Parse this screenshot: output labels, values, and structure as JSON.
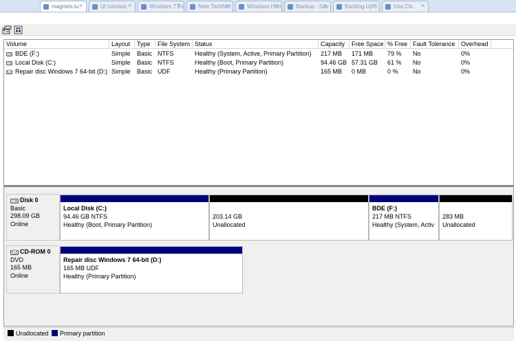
{
  "browser": {
    "tabs": [
      {
        "label": "magnets.tu",
        "active": true
      },
      {
        "label": "UI tutorials",
        "active": false
      },
      {
        "label": "Windows 7 Fo",
        "active": false
      },
      {
        "label": "New TechNet",
        "active": false
      },
      {
        "label": "Windows Hum",
        "active": false
      },
      {
        "label": "Backup - Sav",
        "active": false
      },
      {
        "label": "Backing Up ti",
        "active": false
      },
      {
        "label": "Usa Cls",
        "active": false
      }
    ],
    "tab_close_icon": "close-icon"
  },
  "toolbar": {
    "buttons": [
      {
        "name": "properties-button",
        "icon": "properties-icon"
      },
      {
        "name": "help-button",
        "icon": "help-icon"
      }
    ]
  },
  "volume_list": {
    "columns": [
      "Volume",
      "Layout",
      "Type",
      "File System",
      "Status",
      "Capacity",
      "Free Space",
      "% Free",
      "Fault Tolerance",
      "Overhead"
    ],
    "rows": [
      {
        "volume": "BDE (F:)",
        "icon": "drive-icon",
        "layout": "Simple",
        "type": "Basic",
        "fs": "NTFS",
        "status": "Healthy (System, Active, Primary Partition)",
        "capacity": "217 MB",
        "free": "171 MB",
        "pct": "79 %",
        "fault": "No",
        "overhead": "0%"
      },
      {
        "volume": "Local Disk (C:)",
        "icon": "drive-icon",
        "layout": "Simple",
        "type": "Basic",
        "fs": "NTFS",
        "status": "Healthy (Boot, Primary Partition)",
        "capacity": "94.46 GB",
        "free": "57.31 GB",
        "pct": "61 %",
        "fault": "No",
        "overhead": "0%"
      },
      {
        "volume": "Repair disc Windows 7 64-bit (D:)",
        "icon": "cd-drive-icon",
        "layout": "Simple",
        "type": "Basic",
        "fs": "UDF",
        "status": "Healthy (Primary Partition)",
        "capacity": "165 MB",
        "free": "0 MB",
        "pct": "0 %",
        "fault": "No",
        "overhead": "0%"
      }
    ]
  },
  "disks": [
    {
      "title": "Disk 0",
      "icon": "hard-disk-icon",
      "kind": "Basic",
      "size": "298.09 GB",
      "state": "Online",
      "partitions": [
        {
          "name": "Local Disk  (C:)",
          "line2": "94.46 GB NTFS",
          "line3": "Healthy (Boot, Primary Partition)",
          "kind": "primary"
        },
        {
          "name": "",
          "line2": "203.14 GB",
          "line3": "Unallocated",
          "kind": "unallocated"
        },
        {
          "name": "BDE  (F:)",
          "line2": "217 MB NTFS",
          "line3": "Healthy (System, Activ",
          "kind": "primary"
        },
        {
          "name": "",
          "line2": "283 MB",
          "line3": "Unallocated",
          "kind": "unallocated"
        }
      ]
    },
    {
      "title": "CD-ROM 0",
      "icon": "cd-rom-icon",
      "kind": "DVD",
      "size": "165 MB",
      "state": "Online",
      "partitions": [
        {
          "name": "Repair disc Windows 7 64-bit  (D:)",
          "line2": "165 MB UDF",
          "line3": "Healthy (Primary Partition)",
          "kind": "primary"
        }
      ]
    }
  ],
  "legend": [
    {
      "label": "Unallocated",
      "color": "#000000"
    },
    {
      "label": "Primary partition",
      "color": "#00007f"
    }
  ],
  "colors": {
    "primary": "#00007f",
    "unallocated": "#000000"
  }
}
